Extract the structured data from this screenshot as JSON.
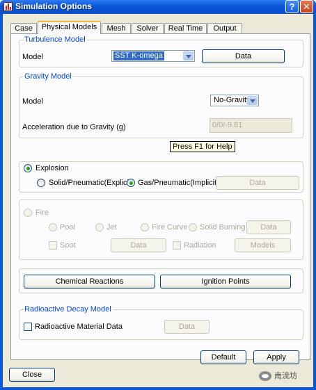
{
  "window": {
    "title": "Simulation Options"
  },
  "title_buttons": {
    "help": "?",
    "close": "✕"
  },
  "tabs": [
    {
      "label": "Case"
    },
    {
      "label": "Physical Models"
    },
    {
      "label": "Mesh"
    },
    {
      "label": "Solver"
    },
    {
      "label": "Real Time"
    },
    {
      "label": "Output"
    }
  ],
  "turbulence": {
    "legend": "Turbulence Model",
    "model_label": "Model",
    "model_value": "SST K-omega",
    "data_button": "Data"
  },
  "gravity": {
    "legend": "Gravity Model",
    "model_label": "Model",
    "model_value": "No-Gravity",
    "accel_label": "Acceleration due to Gravity (g)",
    "accel_value": "0/0/-9.81"
  },
  "tooltip": "Press F1 for Help",
  "explosion": {
    "label": "Explosion",
    "solid_label": "Solid/Pneumatic(Explicit)",
    "gas_label": "Gas/Pneumatic(Implicit)",
    "data_button": "Data"
  },
  "fire": {
    "label": "Fire",
    "pool": "Pool",
    "jet": "Jet",
    "fire_curve": "Fire Curve",
    "solid_burning": "Solid Burning",
    "data_button": "Data",
    "soot": "Soot",
    "soot_data_button": "Data",
    "radiation": "Radiation",
    "models_button": "Models"
  },
  "actions": {
    "chemical_reactions": "Chemical Reactions",
    "ignition_points": "Ignition Points"
  },
  "radioactive": {
    "legend": "Radioactive Decay Model",
    "material_label": "Radioactive Material Data",
    "data_button": "Data"
  },
  "footer": {
    "default_button": "Default",
    "apply_button": "Apply",
    "close_button": "Close"
  },
  "watermark": {
    "text": "南流坊"
  }
}
